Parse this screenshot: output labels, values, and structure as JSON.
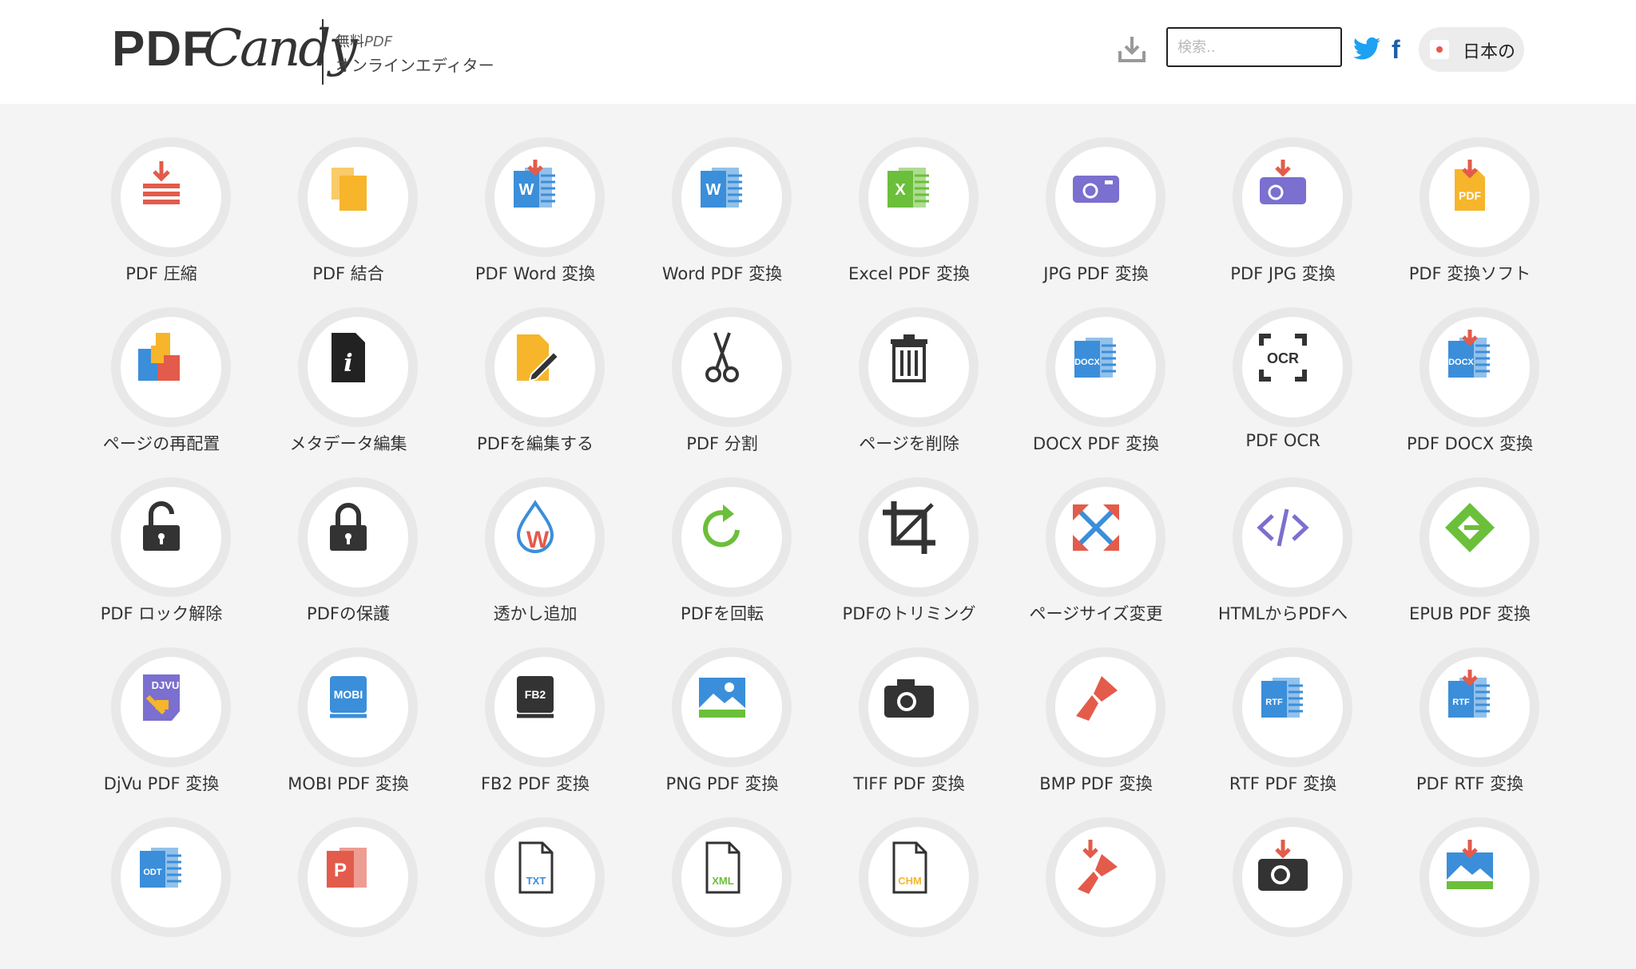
{
  "header": {
    "logo_main": "PDF",
    "logo_script": "Candy",
    "tag_prefix": "無料",
    "tag_pdf": "PDF",
    "tag_line2": "オンラインエディター",
    "search_placeholder": "検索..",
    "lang_label": "日本の"
  },
  "tools": [
    {
      "label": "PDF 圧縮",
      "icon": "compress-icon"
    },
    {
      "label": "PDF 結合",
      "icon": "merge-icon"
    },
    {
      "label": "PDF Word 変換",
      "icon": "pdf-to-word-icon"
    },
    {
      "label": "Word PDF 変換",
      "icon": "word-icon"
    },
    {
      "label": "Excel PDF 変換",
      "icon": "excel-icon"
    },
    {
      "label": "JPG PDF 変換",
      "icon": "jpg-icon"
    },
    {
      "label": "PDF JPG 変換",
      "icon": "pdf-to-jpg-icon"
    },
    {
      "label": "PDF 変換ソフト",
      "icon": "pdf-converter-icon"
    },
    {
      "label": "ページの再配置",
      "icon": "rearrange-pages-icon"
    },
    {
      "label": "メタデータ編集",
      "icon": "metadata-icon"
    },
    {
      "label": "PDFを編集する",
      "icon": "edit-pdf-icon"
    },
    {
      "label": "PDF 分割",
      "icon": "scissors-icon"
    },
    {
      "label": "ページを削除",
      "icon": "trash-icon"
    },
    {
      "label": "DOCX PDF 変換",
      "icon": "docx-icon"
    },
    {
      "label": "PDF OCR",
      "icon": "ocr-icon"
    },
    {
      "label": "PDF DOCX 変換",
      "icon": "pdf-to-docx-icon"
    },
    {
      "label": "PDF ロック解除",
      "icon": "unlock-icon"
    },
    {
      "label": "PDFの保護",
      "icon": "lock-icon"
    },
    {
      "label": "透かし追加",
      "icon": "watermark-icon"
    },
    {
      "label": "PDFを回転",
      "icon": "rotate-icon"
    },
    {
      "label": "PDFのトリミング",
      "icon": "crop-icon"
    },
    {
      "label": "ページサイズ変更",
      "icon": "resize-icon"
    },
    {
      "label": "HTMLからPDFへ",
      "icon": "html-code-icon"
    },
    {
      "label": "EPUB PDF 変換",
      "icon": "epub-icon"
    },
    {
      "label": "DjVu PDF 変換",
      "icon": "djvu-icon"
    },
    {
      "label": "MOBI PDF 変換",
      "icon": "mobi-icon"
    },
    {
      "label": "FB2 PDF 変換",
      "icon": "fb2-icon"
    },
    {
      "label": "PNG PDF 変換",
      "icon": "png-image-icon"
    },
    {
      "label": "TIFF PDF 変換",
      "icon": "camera-icon"
    },
    {
      "label": "BMP PDF 変換",
      "icon": "paintbrush-icon"
    },
    {
      "label": "RTF PDF 変換",
      "icon": "rtf-icon"
    },
    {
      "label": "PDF RTF 変換",
      "icon": "pdf-to-rtf-icon"
    },
    {
      "label": "",
      "icon": "odt-icon"
    },
    {
      "label": "",
      "icon": "powerpoint-icon"
    },
    {
      "label": "",
      "icon": "txt-file-icon"
    },
    {
      "label": "",
      "icon": "xml-file-icon"
    },
    {
      "label": "",
      "icon": "chm-file-icon"
    },
    {
      "label": "",
      "icon": "pdf-to-bmp-icon"
    },
    {
      "label": "",
      "icon": "pdf-to-tiff-icon"
    },
    {
      "label": "",
      "icon": "pdf-to-png-icon"
    }
  ],
  "colors": {
    "red": "#e35b4b",
    "blue": "#3b8ed9",
    "green": "#6bbf3a",
    "purple": "#7b6fcf",
    "orange": "#f6b52b",
    "dark": "#333333"
  }
}
